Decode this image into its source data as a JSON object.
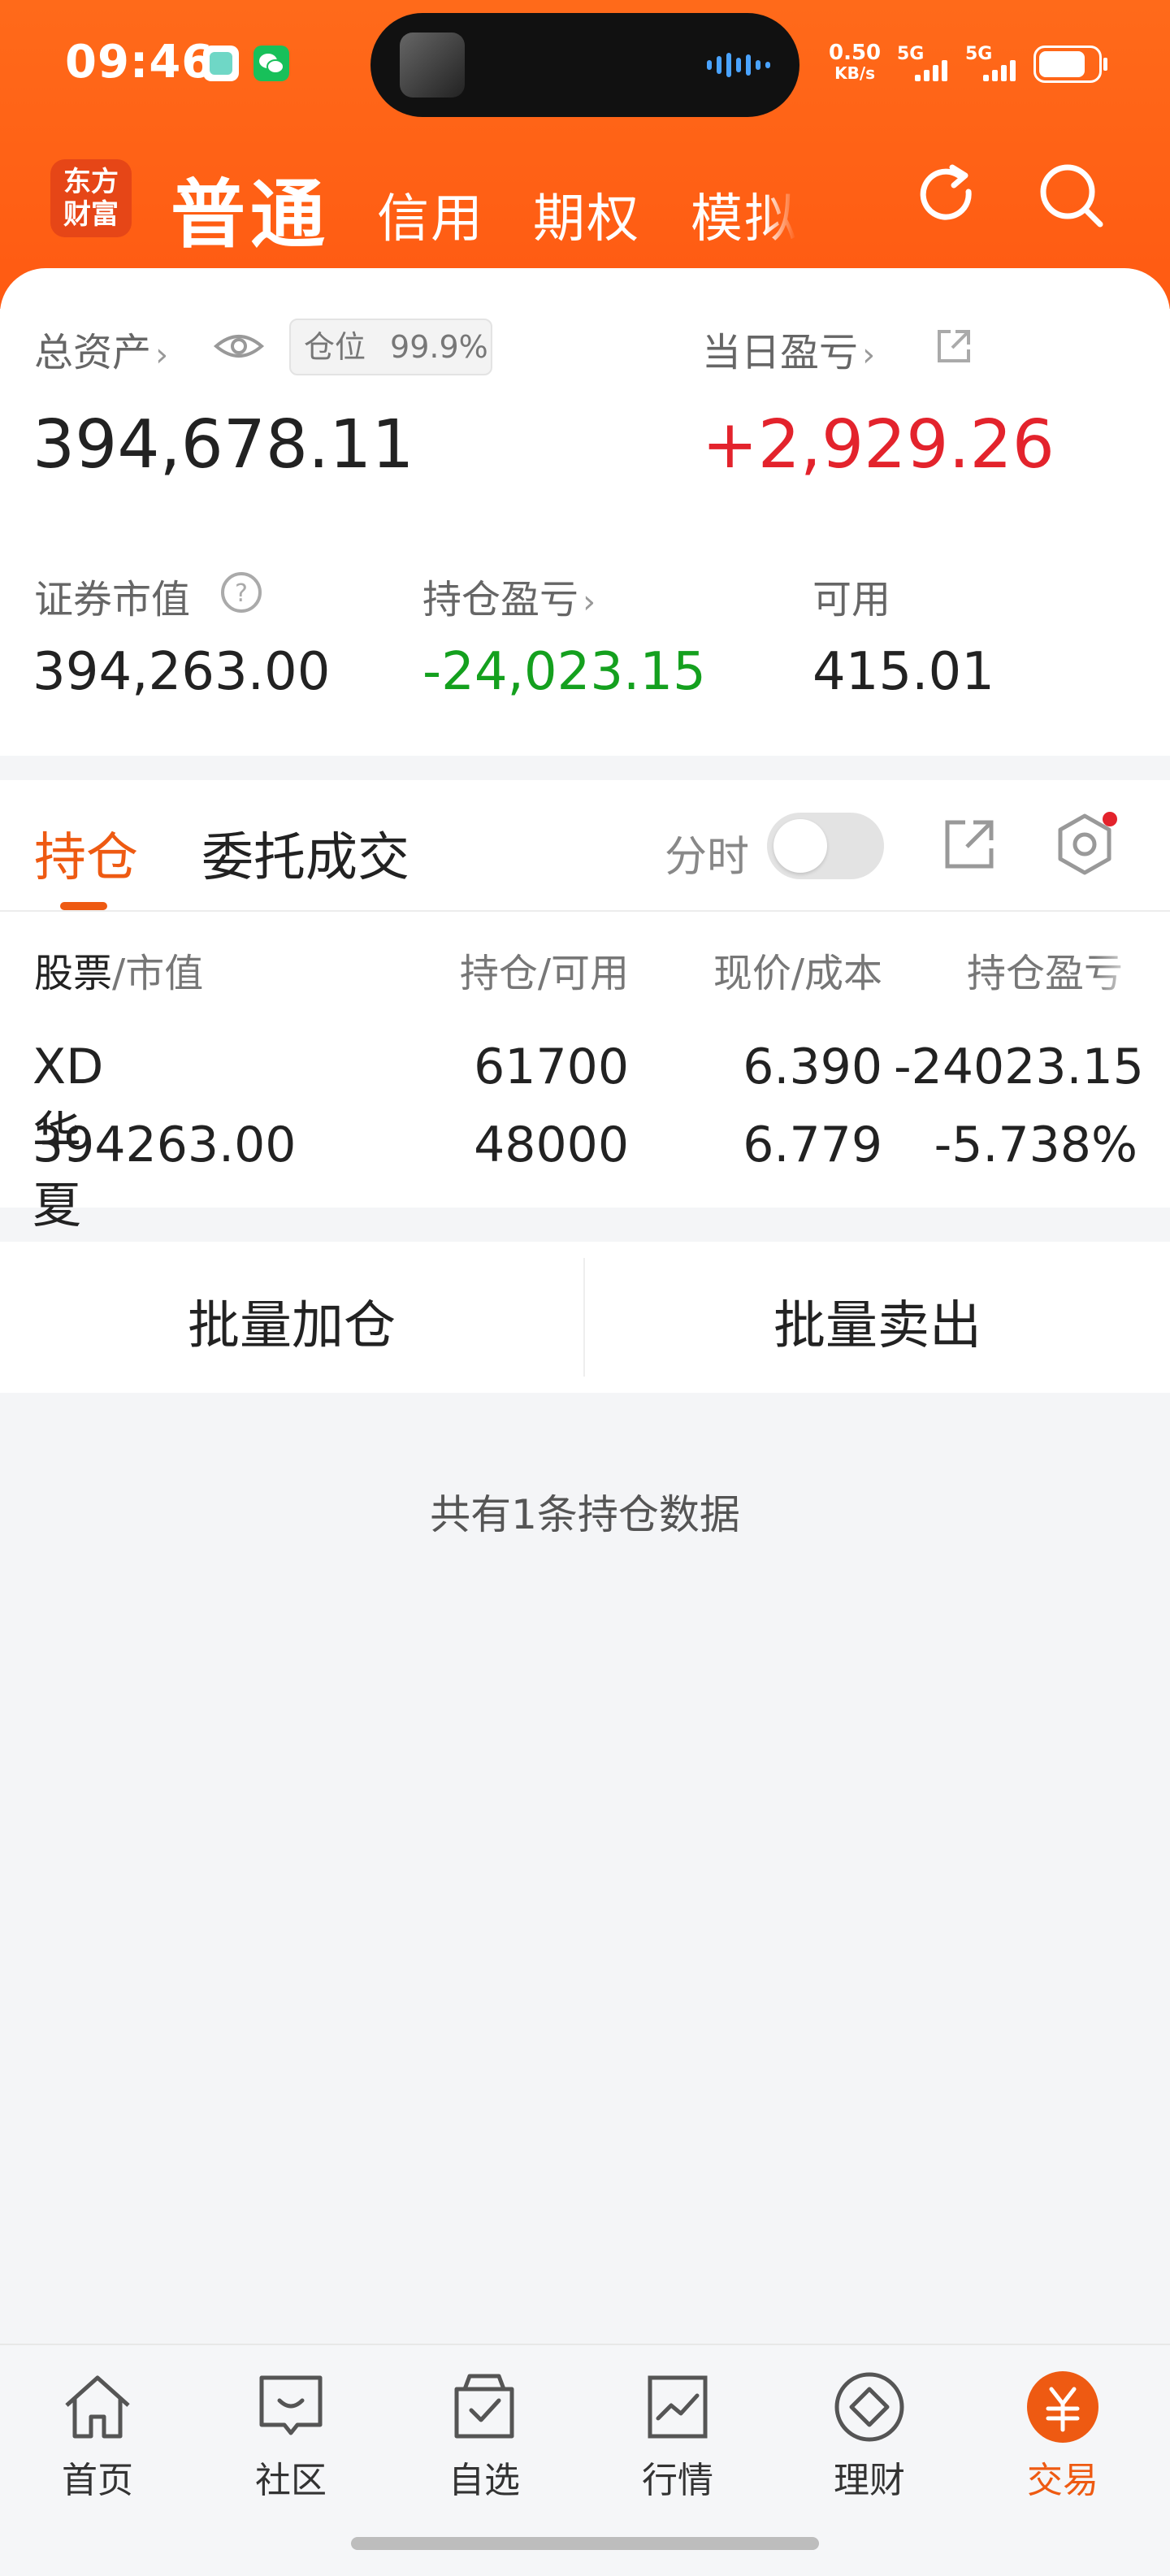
{
  "status_bar": {
    "time": "09:46",
    "net_speed_value": "0.50",
    "net_speed_unit": "KB/s",
    "signal1_label": "5G",
    "signal2_label": "5G"
  },
  "header": {
    "logo_text_line1": "东方",
    "logo_text_line2": "财富",
    "tabs": [
      "普通",
      "信用",
      "期权",
      "模拟"
    ],
    "accent_color": "#ff6a1a"
  },
  "summary": {
    "total_assets_label": "总资产",
    "position_label": "仓位",
    "position_value": "99.9%",
    "total_assets_value": "394,678.11",
    "daily_pnl_label": "当日盈亏",
    "daily_pnl_value": "+2,929.26",
    "market_value_label": "证券市值",
    "market_value_value": "394,263.00",
    "holding_pnl_label": "持仓盈亏",
    "holding_pnl_value": "-24,023.15",
    "available_label": "可用",
    "available_value": "415.01"
  },
  "holdings": {
    "tab_active": "持仓",
    "tab_inactive": "委托成交",
    "fenshi_label": "分时",
    "columns": {
      "col1_a": "股票",
      "col1_b": "/市值",
      "col2": "持仓/可用",
      "col3": "现价/成本",
      "col4": "持仓盈亏"
    },
    "rows": [
      {
        "name": "XD华夏银",
        "market_value": "394263.00",
        "position": "61700",
        "available": "48000",
        "price": "6.390",
        "cost": "6.779",
        "pnl": "-24023.15",
        "pnl_pct": "-5.738%"
      }
    ]
  },
  "batch": {
    "add_label": "批量加仓",
    "sell_label": "批量卖出"
  },
  "count_note": "共有1条持仓数据",
  "nav": [
    {
      "label": "首页",
      "icon": "home-icon"
    },
    {
      "label": "社区",
      "icon": "chat-icon"
    },
    {
      "label": "自选",
      "icon": "watchlist-icon"
    },
    {
      "label": "行情",
      "icon": "chart-icon"
    },
    {
      "label": "理财",
      "icon": "diamond-icon"
    },
    {
      "label": "交易",
      "icon": "yuan-icon"
    }
  ]
}
